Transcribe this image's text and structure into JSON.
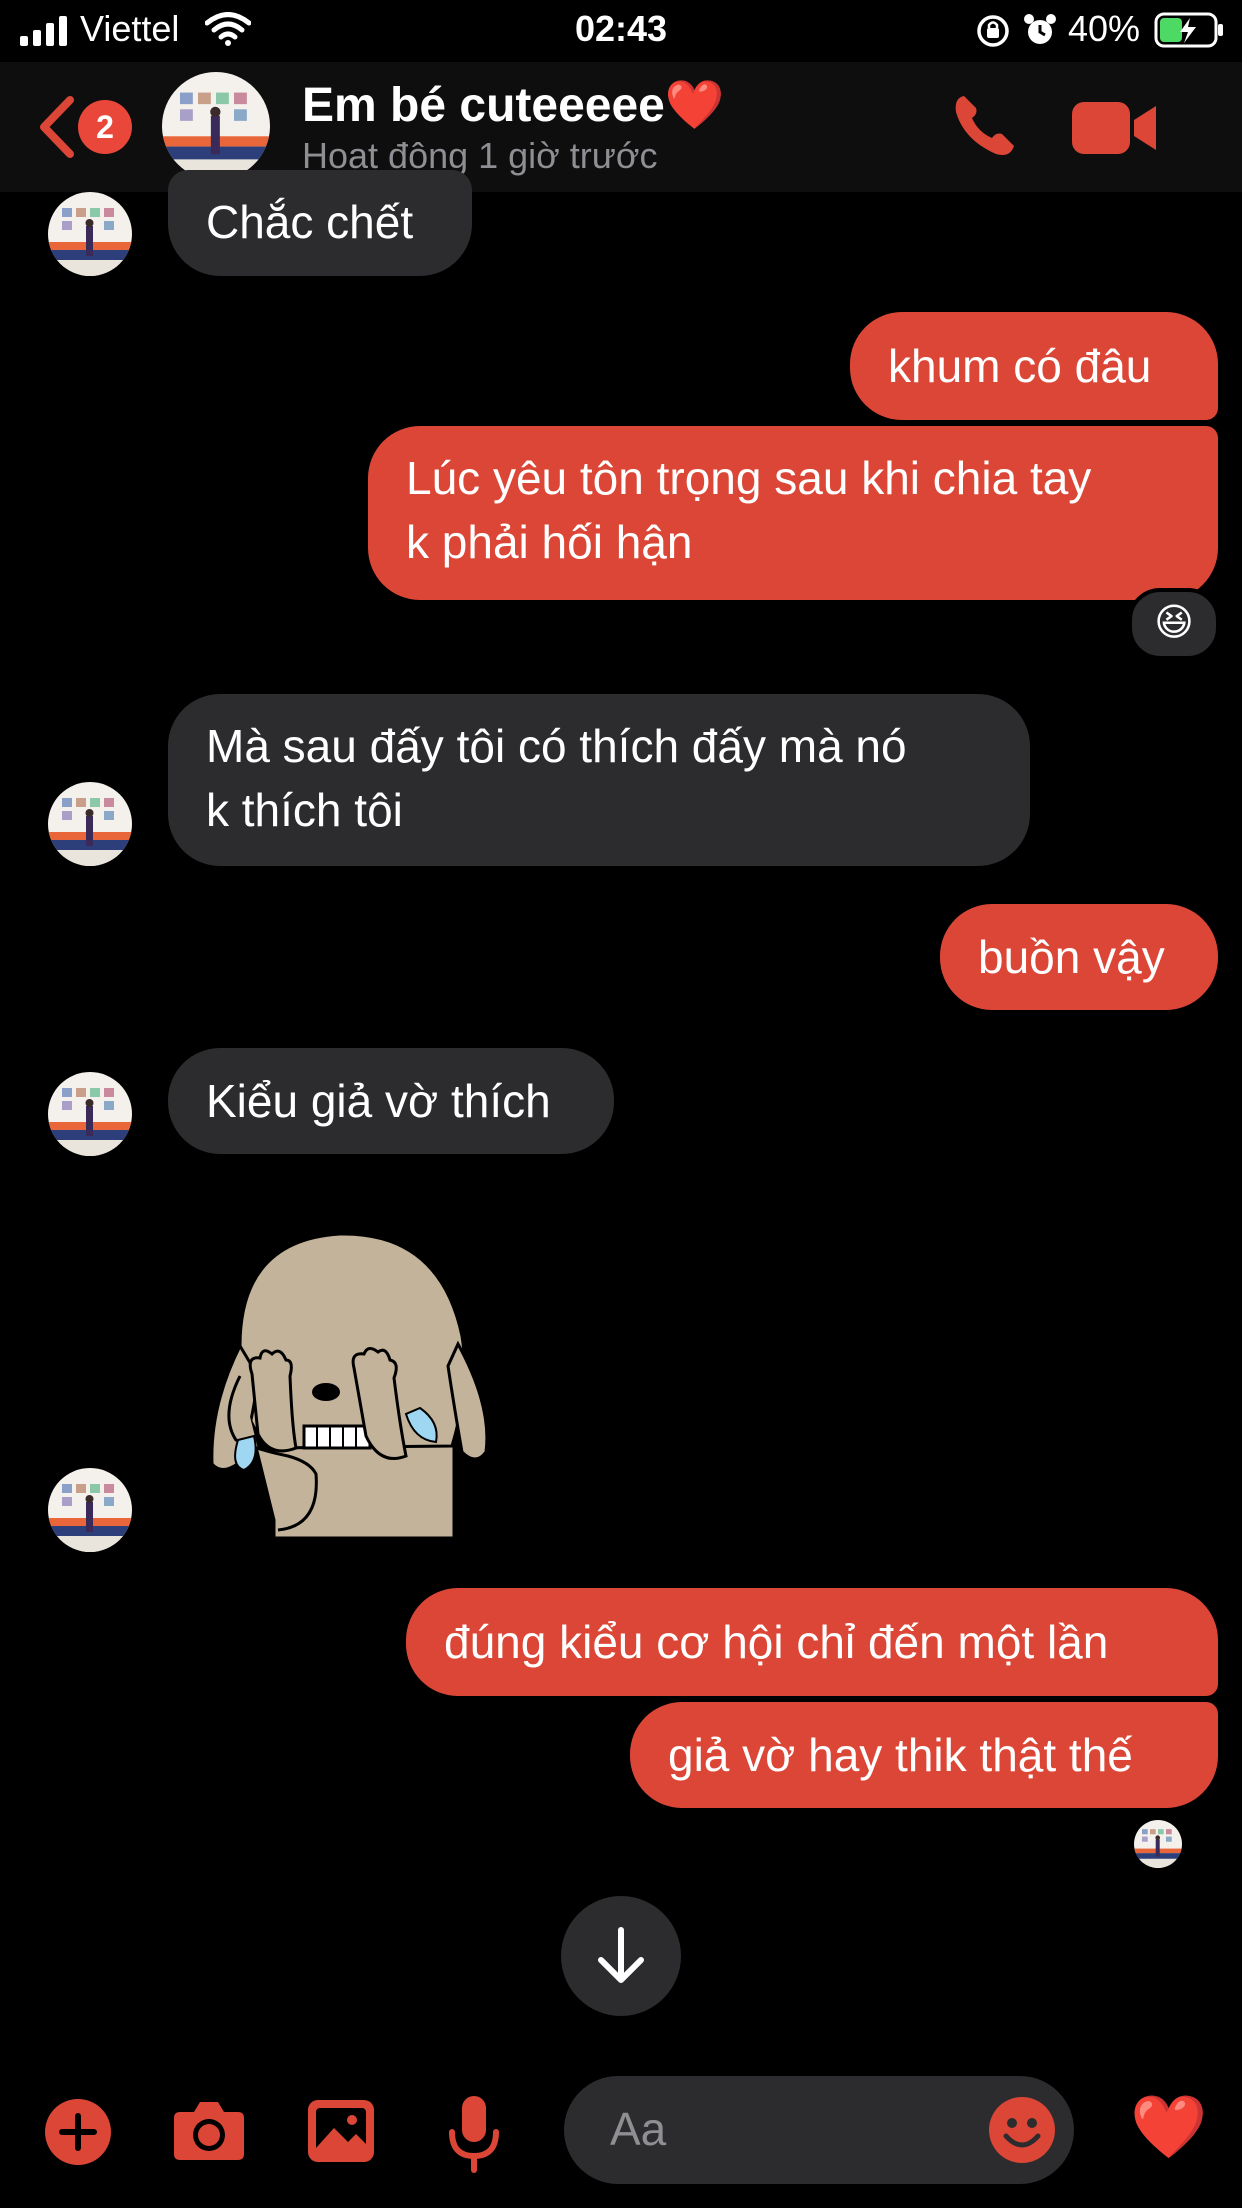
{
  "status_bar": {
    "carrier": "Viettel",
    "time": "02:43",
    "battery": "40%"
  },
  "header": {
    "back_badge_count": "2",
    "contact_name": "Em bé cuteeeee",
    "contact_heart": "❤️",
    "contact_status": "Hoạt động 1 giờ trước"
  },
  "messages": [
    {
      "from": "them",
      "text": "Chắc chết"
    },
    {
      "from": "me",
      "text": "khum có đâu"
    },
    {
      "from": "me",
      "lines": [
        "Lúc yêu tôn trọng sau khi chia tay",
        "k phải hối hận"
      ],
      "reaction": "😆"
    },
    {
      "from": "them",
      "lines": [
        "Mà sau đấy tôi có thích đấy mà nó",
        "k thích tôi"
      ]
    },
    {
      "from": "me",
      "text": "buồn vậy"
    },
    {
      "from": "them",
      "text": "Kiểu giả vờ thích"
    },
    {
      "from": "them",
      "type": "sticker",
      "sticker": "crying-dog"
    },
    {
      "from": "me",
      "text": "đúng kiểu cơ hội chỉ đến một lần"
    },
    {
      "from": "me",
      "text": "giả vờ hay thik thật thế"
    }
  ],
  "composer": {
    "placeholder": "Aa",
    "quick_reaction": "❤️"
  },
  "colors": {
    "accent": "#dc4636",
    "incoming_bubble": "#2c2c2e",
    "background": "#000000"
  },
  "icons": [
    "back-icon",
    "phone-icon",
    "video-icon",
    "plus-icon",
    "camera-icon",
    "image-icon",
    "mic-icon",
    "smiley-icon",
    "heart-icon",
    "arrow-down-icon"
  ]
}
